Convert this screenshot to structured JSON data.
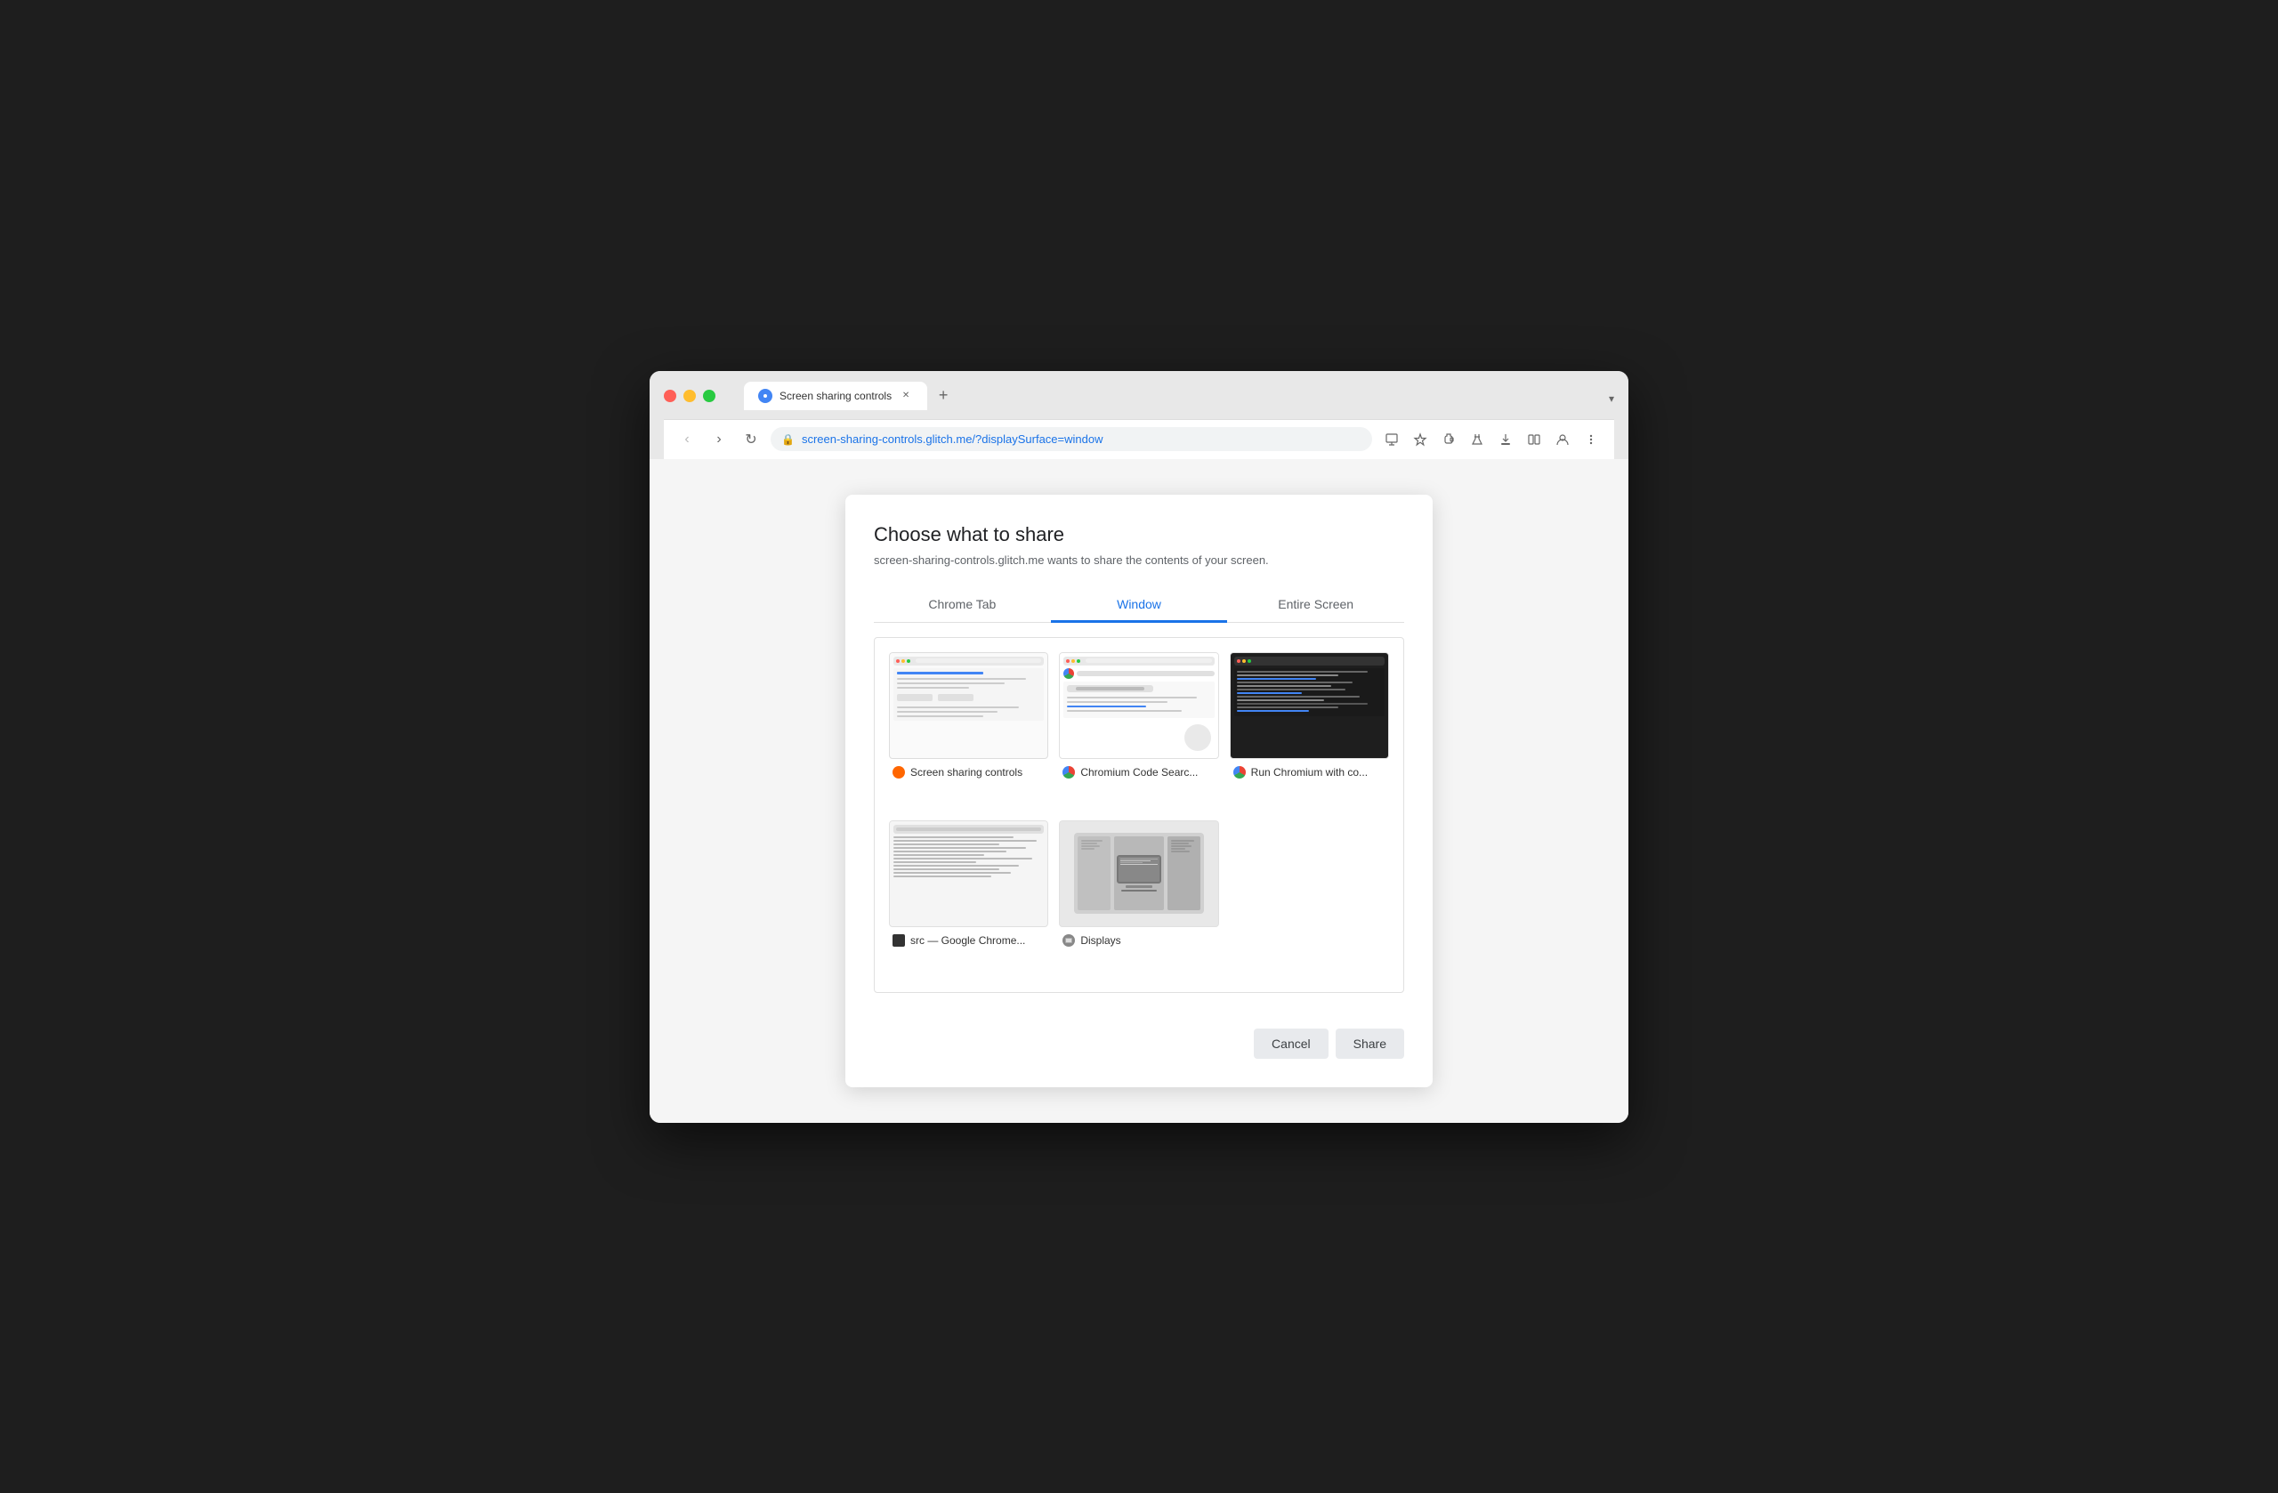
{
  "browser": {
    "tab_title": "Screen sharing controls",
    "tab_overflow_label": "▾",
    "new_tab_label": "+",
    "address": "screen-sharing-controls.glitch.me/?displaySurface=window",
    "nav": {
      "back_label": "‹",
      "forward_label": "›",
      "reload_label": "↺"
    },
    "toolbar_icons": [
      "share",
      "star",
      "extension",
      "lab",
      "download",
      "split",
      "profile",
      "menu"
    ]
  },
  "dialog": {
    "title": "Choose what to share",
    "subtitle": "screen-sharing-controls.glitch.me wants to share the contents of your screen.",
    "tabs": [
      {
        "id": "chrome-tab",
        "label": "Chrome Tab",
        "active": false
      },
      {
        "id": "window",
        "label": "Window",
        "active": true
      },
      {
        "id": "entire-screen",
        "label": "Entire Screen",
        "active": false
      }
    ],
    "windows": [
      {
        "id": "w1",
        "name": "Screen sharing controls",
        "favicon_type": "glitch",
        "favicon_color": "#ff6600"
      },
      {
        "id": "w2",
        "name": "Chromium Code Searc...",
        "favicon_type": "chrome",
        "favicon_color": null
      },
      {
        "id": "w3",
        "name": "Run Chromium with co...",
        "favicon_type": "chrome",
        "favicon_color": null
      },
      {
        "id": "w4",
        "name": "src — Google Chrome...",
        "favicon_type": "dark",
        "favicon_color": "#333"
      },
      {
        "id": "w5",
        "name": "Displays",
        "favicon_type": "display",
        "favicon_color": "#888"
      }
    ],
    "footer": {
      "cancel_label": "Cancel",
      "share_label": "Share"
    }
  }
}
